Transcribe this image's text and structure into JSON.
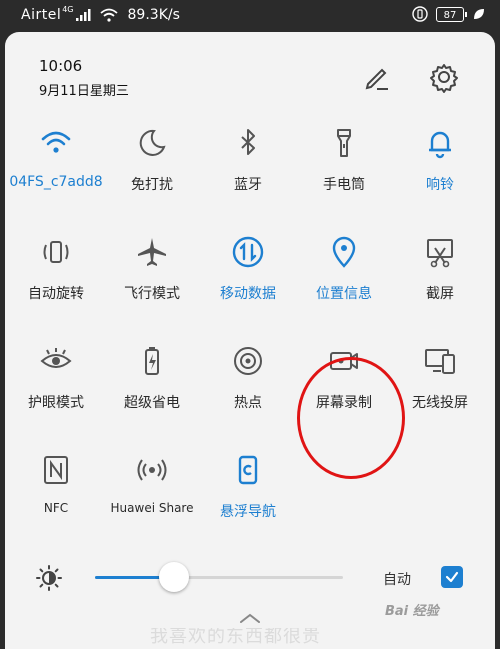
{
  "status_bar": {
    "carrier": "Airtel",
    "network": "4G",
    "speed": "89.3K/s",
    "battery": "87"
  },
  "header": {
    "time": "10:06",
    "date": "9月11日星期三"
  },
  "tiles": [
    {
      "label": "04FS_c7add8",
      "icon": "wifi-icon",
      "active": true
    },
    {
      "label": "免打扰",
      "icon": "moon-icon",
      "active": false
    },
    {
      "label": "蓝牙",
      "icon": "bluetooth-icon",
      "active": false
    },
    {
      "label": "手电筒",
      "icon": "flashlight-icon",
      "active": false
    },
    {
      "label": "响铃",
      "icon": "bell-icon",
      "active": true
    },
    {
      "label": "自动旋转",
      "icon": "auto-rotate-icon",
      "active": false
    },
    {
      "label": "飞行模式",
      "icon": "airplane-icon",
      "active": false
    },
    {
      "label": "移动数据",
      "icon": "mobile-data-icon",
      "active": true
    },
    {
      "label": "位置信息",
      "icon": "location-icon",
      "active": true
    },
    {
      "label": "截屏",
      "icon": "screenshot-icon",
      "active": false
    },
    {
      "label": "护眼模式",
      "icon": "eye-icon",
      "active": false
    },
    {
      "label": "超级省电",
      "icon": "battery-saver-icon",
      "active": false
    },
    {
      "label": "热点",
      "icon": "hotspot-icon",
      "active": false
    },
    {
      "label": "屏幕录制",
      "icon": "screen-record-icon",
      "active": false
    },
    {
      "label": "无线投屏",
      "icon": "wireless-projection-icon",
      "active": false
    },
    {
      "label": "NFC",
      "icon": "nfc-icon",
      "active": false
    },
    {
      "label": "Huawei Share",
      "icon": "huawei-share-icon",
      "active": false
    },
    {
      "label": "悬浮导航",
      "icon": "floating-nav-icon",
      "active": true
    }
  ],
  "brightness": {
    "level": 0.32,
    "auto_label": "自动",
    "auto_checked": true
  },
  "colors": {
    "accent": "#1d7fd0",
    "panel": "#f3f3f3",
    "annotation": "#e01414"
  },
  "background_text": "我喜欢的东西都很贵",
  "watermark": "Bai 经验"
}
